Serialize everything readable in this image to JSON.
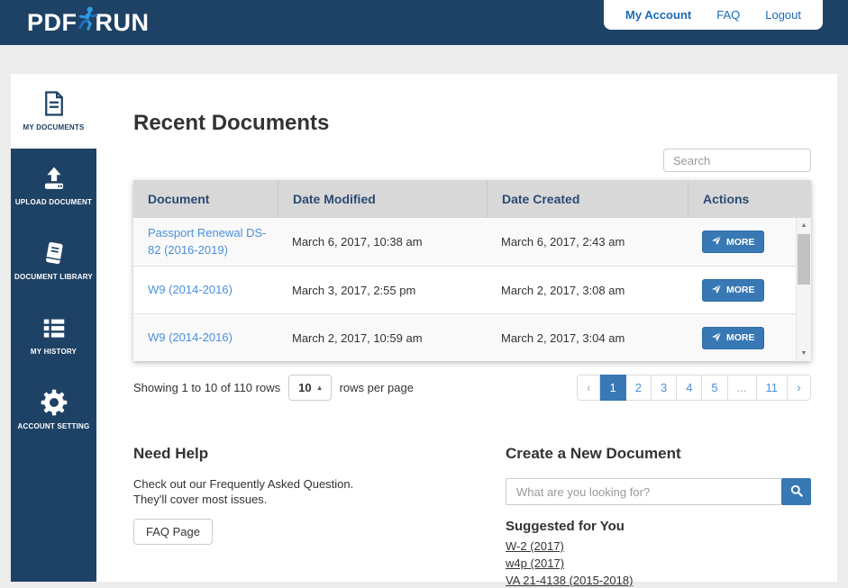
{
  "brand": {
    "pdf": "PDF",
    "run": "RUN"
  },
  "nav": {
    "my_account": "My Account",
    "faq": "FAQ",
    "logout": "Logout"
  },
  "sidebar": {
    "items": [
      {
        "label": "MY DOCUMENTS",
        "icon": "document-icon",
        "active": true
      },
      {
        "label": "UPLOAD DOCUMENT",
        "icon": "upload-icon",
        "active": false
      },
      {
        "label": "DOCUMENT LIBRARY",
        "icon": "book-icon",
        "active": false
      },
      {
        "label": "MY HISTORY",
        "icon": "list-icon",
        "active": false
      },
      {
        "label": "ACCOUNT SETTING",
        "icon": "gear-icon",
        "active": false
      }
    ]
  },
  "main": {
    "title": "Recent Documents",
    "search_placeholder": "Search",
    "table": {
      "columns": [
        "Document",
        "Date Modified",
        "Date Created",
        "Actions"
      ],
      "rows": [
        {
          "document": "Passport Renewal DS-82 (2016-2019)",
          "date_modified": "March 6, 2017, 10:38 am",
          "date_created": "March 6, 2017, 2:43 am",
          "action_label": "MORE"
        },
        {
          "document": "W9 (2014-2016)",
          "date_modified": "March 3, 2017, 2:55 pm",
          "date_created": "March 2, 2017, 3:08 am",
          "action_label": "MORE"
        },
        {
          "document": "W9 (2014-2016)",
          "date_modified": "March 2, 2017, 10:59 am",
          "date_created": "March 2, 2017, 3:04 am",
          "action_label": "MORE"
        }
      ]
    },
    "pagination": {
      "summary": "Showing 1 to 10 of 110 rows",
      "page_size": "10",
      "rows_per_page": "rows per page",
      "prev": "‹",
      "next": "›",
      "pages": [
        "1",
        "2",
        "3",
        "4",
        "5",
        "...",
        "11"
      ],
      "active_page": "1"
    }
  },
  "help": {
    "title": "Need Help",
    "line1": "Check out our Frequently Asked Question.",
    "line2": "They'll cover most issues.",
    "button": "FAQ Page"
  },
  "create": {
    "title": "Create a New Document",
    "search_placeholder": "What are you looking for?",
    "suggested_title": "Suggested for You",
    "links": [
      "W-2 (2017)",
      "w4p (2017)",
      "VA 21-4138 (2015-2018)"
    ]
  },
  "icons": {
    "scroll_up": "▲",
    "scroll_down": "▼",
    "caret_up": "▴"
  },
  "colors": {
    "navy": "#1e4265",
    "accent_blue": "#3878b4",
    "link_blue": "#4a90d9",
    "table_header_bg": "#d8d8d8",
    "page_bg": "#ececec"
  }
}
